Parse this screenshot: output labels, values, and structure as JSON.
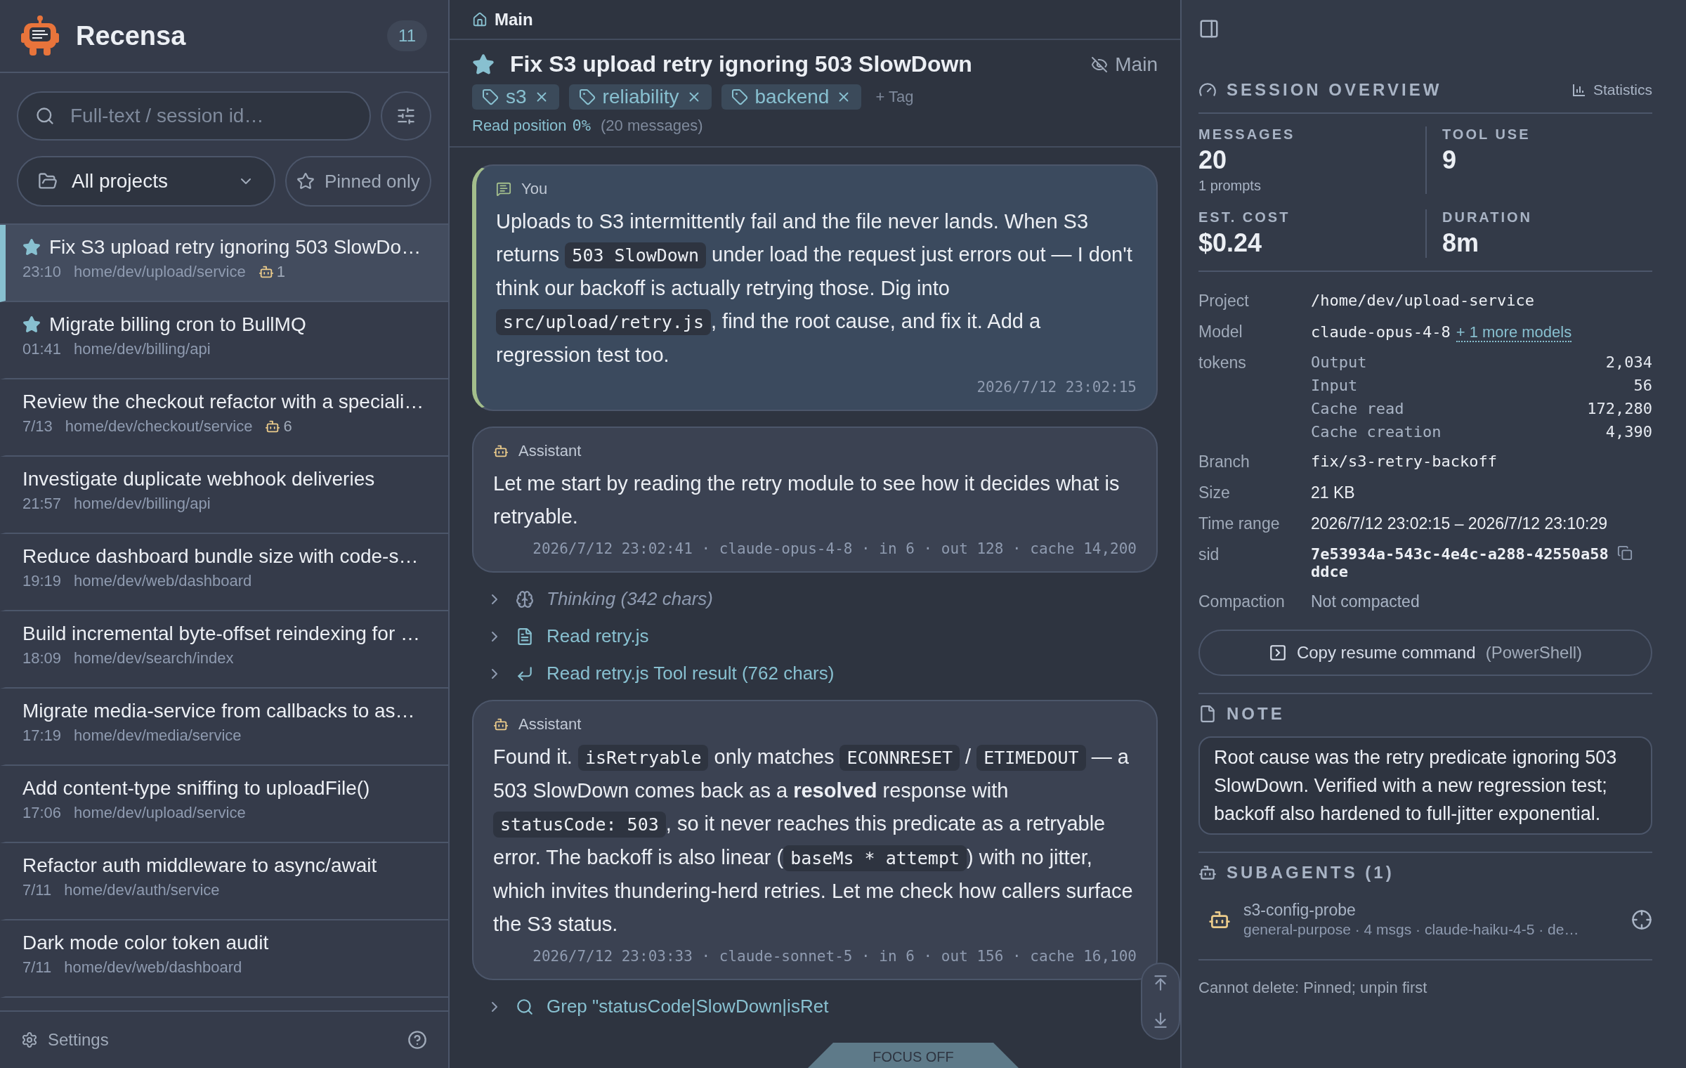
{
  "app": {
    "name": "Recensa",
    "session_count": "11"
  },
  "search": {
    "placeholder": "Full-text / session id…"
  },
  "filters": {
    "project": "All projects",
    "pinned_label": "Pinned only",
    "pinned_only": false
  },
  "sessions": [
    {
      "title": "Fix S3 upload retry ignoring 503 SlowDo…",
      "time": "23:10",
      "path": "home/dev/upload/service",
      "pinned": true,
      "selected": true,
      "subagents": "1"
    },
    {
      "title": "Migrate billing cron to BullMQ",
      "time": "01:41",
      "path": "home/dev/billing/api",
      "pinned": true,
      "selected": false
    },
    {
      "title": "Review the checkout refactor with a speciali…",
      "time": "7/13",
      "path": "home/dev/checkout/service",
      "pinned": false,
      "selected": false,
      "subagents": "6"
    },
    {
      "title": "Investigate duplicate webhook deliveries",
      "time": "21:57",
      "path": "home/dev/billing/api",
      "pinned": false,
      "selected": false
    },
    {
      "title": "Reduce dashboard bundle size with code-s…",
      "time": "19:19",
      "path": "home/dev/web/dashboard",
      "pinned": false,
      "selected": false
    },
    {
      "title": "Build incremental byte-offset reindexing for …",
      "time": "18:09",
      "path": "home/dev/search/index",
      "pinned": false,
      "selected": false
    },
    {
      "title": "Migrate media-service from callbacks to as…",
      "time": "17:19",
      "path": "home/dev/media/service",
      "pinned": false,
      "selected": false
    },
    {
      "title": "Add content-type sniffing to uploadFile()",
      "time": "17:06",
      "path": "home/dev/upload/service",
      "pinned": false,
      "selected": false
    },
    {
      "title": "Refactor auth middleware to async/await",
      "time": "7/11",
      "path": "home/dev/auth/service",
      "pinned": false,
      "selected": false
    },
    {
      "title": "Dark mode color token audit",
      "time": "7/11",
      "path": "home/dev/web/dashboard",
      "pinned": false,
      "selected": false
    }
  ],
  "footer": {
    "settings": "Settings"
  },
  "breadcrumb": "Main",
  "session": {
    "title": "Fix S3 upload retry ignoring 503 SlowDown",
    "pinned": true,
    "branch_label": "Main",
    "tags": [
      "s3",
      "reliability",
      "backend"
    ],
    "add_tag": "+ Tag",
    "read_label": "Read position",
    "read_value": "0%",
    "message_count": "(20 messages)"
  },
  "messages": [
    {
      "kind": "user",
      "role": "You",
      "body": [
        {
          "kind": "text",
          "text": "Uploads to S3 intermittently fail and the file never lands. When S3 returns "
        },
        {
          "kind": "code",
          "text": "503 SlowDown"
        },
        {
          "kind": "text",
          "text": " under load the request just errors out — I don't think our backoff is actually retrying those. Dig into "
        },
        {
          "kind": "code",
          "text": "src/upload/retry.js"
        },
        {
          "kind": "text",
          "text": ", find the root cause, and fix it. Add a regression test too."
        }
      ],
      "meta": "2026/7/12 23:02:15"
    },
    {
      "kind": "assistant",
      "role": "Assistant",
      "body": [
        {
          "kind": "text",
          "text": "Let me start by reading the retry module to see how it decides what is retryable."
        }
      ],
      "meta": "2026/7/12 23:02:41 · claude-opus-4-8 · in 6 · out 128 · cache 14,200"
    },
    {
      "kind": "thinking",
      "text": "Thinking (342 chars)",
      "expanded": false
    },
    {
      "kind": "read",
      "text": "Read retry.js",
      "expanded": false
    },
    {
      "kind": "result",
      "text": "Read retry.js Tool result (762 chars)",
      "expanded": false
    },
    {
      "kind": "assistant",
      "role": "Assistant",
      "body": [
        {
          "kind": "text",
          "text": "Found it. "
        },
        {
          "kind": "code",
          "text": "isRetryable"
        },
        {
          "kind": "text",
          "text": " only matches "
        },
        {
          "kind": "code",
          "text": "ECONNRESET"
        },
        {
          "kind": "text",
          "text": " / "
        },
        {
          "kind": "code",
          "text": "ETIMEDOUT"
        },
        {
          "kind": "text",
          "text": " — a 503 SlowDown comes back as a "
        },
        {
          "kind": "bold",
          "text": "resolved"
        },
        {
          "kind": "text",
          "text": " response with "
        },
        {
          "kind": "code",
          "text": "statusCode: 503"
        },
        {
          "kind": "text",
          "text": ", so it never reaches this predicate as a retryable error. The backoff is also linear ("
        },
        {
          "kind": "code",
          "text": "baseMs * attempt"
        },
        {
          "kind": "text",
          "text": ") with no jitter, which invites thundering-herd retries. Let me check how callers surface the S3 status."
        }
      ],
      "meta": "2026/7/12 23:03:33 · claude-sonnet-5 · in 6 · out 156 · cache 16,100"
    },
    {
      "kind": "grep",
      "text": "Grep \"statusCode|SlowDown|isRet",
      "expanded": false
    }
  ],
  "focus": {
    "label": "FOCUS OFF"
  },
  "overview": {
    "title": "SESSION OVERVIEW",
    "stats_link": "Statistics",
    "stats": [
      {
        "label": "MESSAGES",
        "value": "20",
        "sub": "1 prompts"
      },
      {
        "label": "TOOL USE",
        "value": "9"
      },
      {
        "label": "EST. COST",
        "value": "$0.24"
      },
      {
        "label": "DURATION",
        "value": "8m"
      }
    ],
    "details": [
      {
        "kind": "mono",
        "label": "Project",
        "value": "/home/dev/upload-service"
      },
      {
        "kind": "model",
        "label": "Model",
        "value": "claude-opus-4-8",
        "link": "+ 1 more models"
      },
      {
        "kind": "tokens",
        "label": "tokens",
        "rows": [
          {
            "name": "Output",
            "value": "2,034"
          },
          {
            "name": "Input",
            "value": "56"
          },
          {
            "name": "Cache read",
            "value": "172,280"
          },
          {
            "name": "Cache creation",
            "value": "4,390"
          }
        ]
      },
      {
        "kind": "mono",
        "label": "Branch",
        "value": "fix/s3-retry-backoff"
      },
      {
        "kind": "plain",
        "label": "Size",
        "value": "21 KB"
      },
      {
        "kind": "plain",
        "label": "Time range",
        "value": "2026/7/12 23:02:15 – 2026/7/12 23:10:29"
      },
      {
        "kind": "copy",
        "label": "sid",
        "value": "7e53934a-543c-4e4c-a288-42550a58ddce"
      },
      {
        "kind": "muted",
        "label": "Compaction",
        "value": "Not compacted"
      }
    ]
  },
  "resume": {
    "label": "Copy resume command",
    "hint": "(PowerShell)"
  },
  "note": {
    "title": "NOTE",
    "text": "Root cause was the retry predicate ignoring 503 SlowDown. Verified with a new regression test; backoff also hardened to full-jitter exponential."
  },
  "subagents": {
    "title": "SUBAGENTS (1)",
    "items": [
      {
        "name": "s3-config-probe",
        "meta": "general-purpose · 4 msgs · claude-haiku-4-5 · de…"
      }
    ]
  },
  "delete_note": "Cannot delete: Pinned; unpin first"
}
